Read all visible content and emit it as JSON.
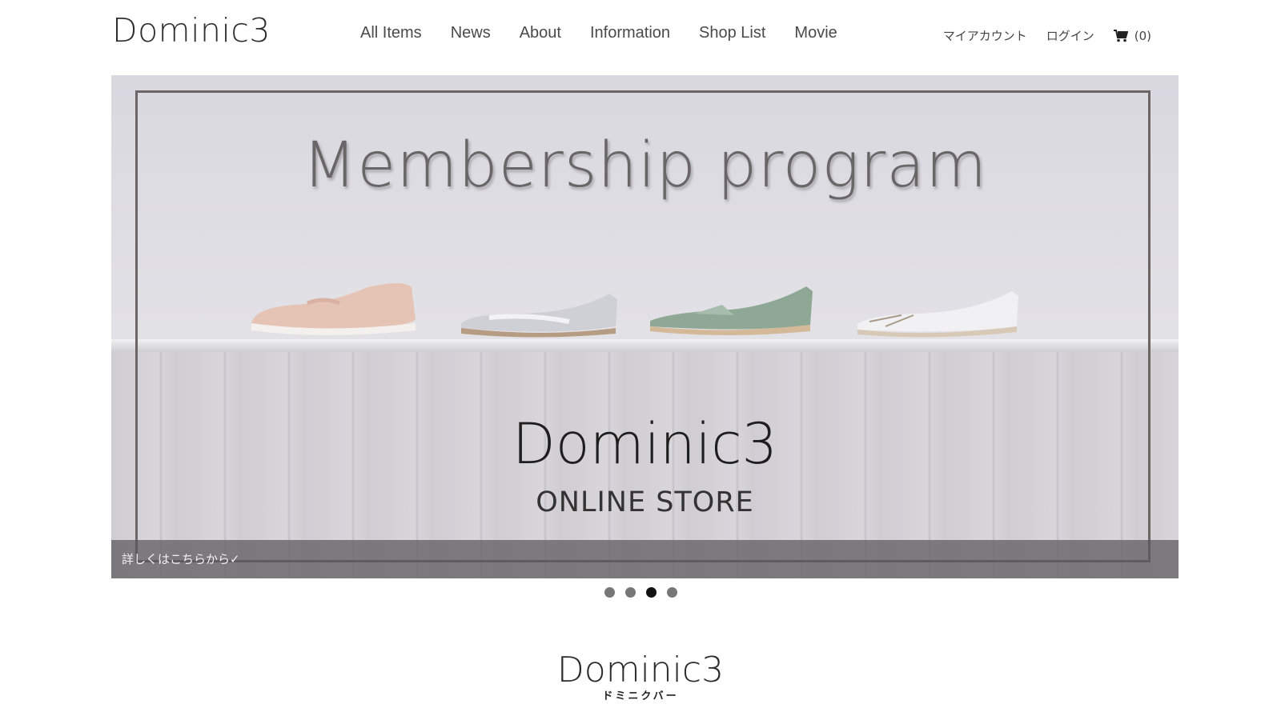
{
  "header": {
    "logo": "Dominic3",
    "nav": [
      "All Items",
      "News",
      "About",
      "Information",
      "Shop List",
      "Movie"
    ],
    "account": "マイアカウント",
    "login": "ログイン",
    "cart_count": "(0)"
  },
  "hero": {
    "headline": "Membership program",
    "brand": "Dominic3",
    "sub": "ONLINE STORE",
    "caption": "詳しくはこちらから✓"
  },
  "slider": {
    "active_index": 3,
    "count": 4
  },
  "footer": {
    "logo": "Dominic3",
    "kana": "ドミニクバー"
  },
  "colors": {
    "frame": "#6d6466",
    "dot_active": "#111111",
    "dot": "#777777"
  }
}
